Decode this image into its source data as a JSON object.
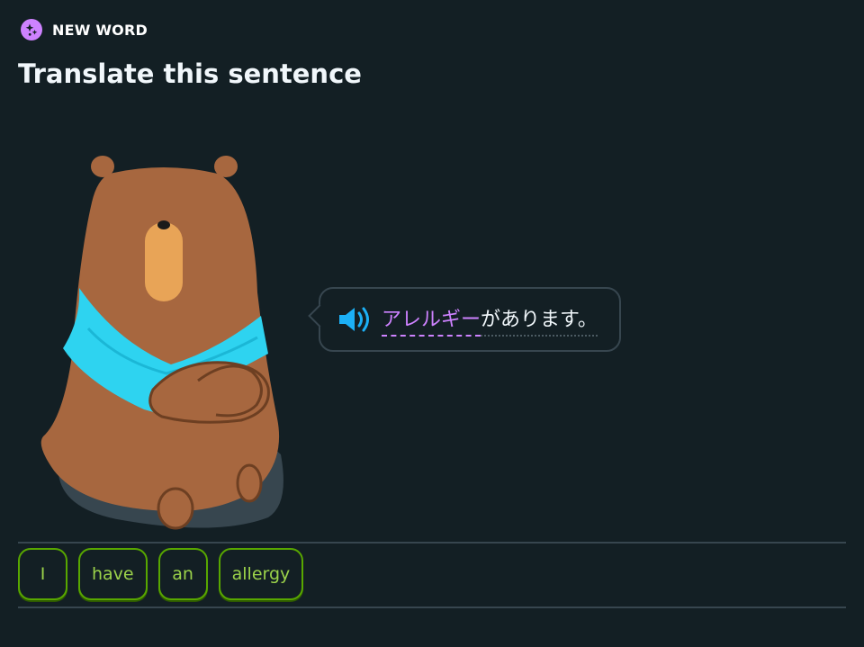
{
  "badge": {
    "label": "NEW WORD",
    "icon": "new-word-sparkle-icon",
    "color": "#ce82ff"
  },
  "title": "Translate this sentence",
  "character": {
    "name": "bear-character",
    "icon": "bear-character-illustration"
  },
  "prompt": {
    "speaker_icon": "speaker-icon",
    "speaker_color": "#1cb0f6",
    "new_word": "アレルギー",
    "new_word_color": "#ce82ff",
    "rest": "があります。"
  },
  "word_bank": {
    "tiles": [
      {
        "label": "I"
      },
      {
        "label": "have"
      },
      {
        "label": "an"
      },
      {
        "label": "allergy"
      }
    ],
    "tile_border_color": "#58a700",
    "tile_text_color": "#9bd24a"
  },
  "colors": {
    "background": "#131f24",
    "border": "#37464f"
  }
}
